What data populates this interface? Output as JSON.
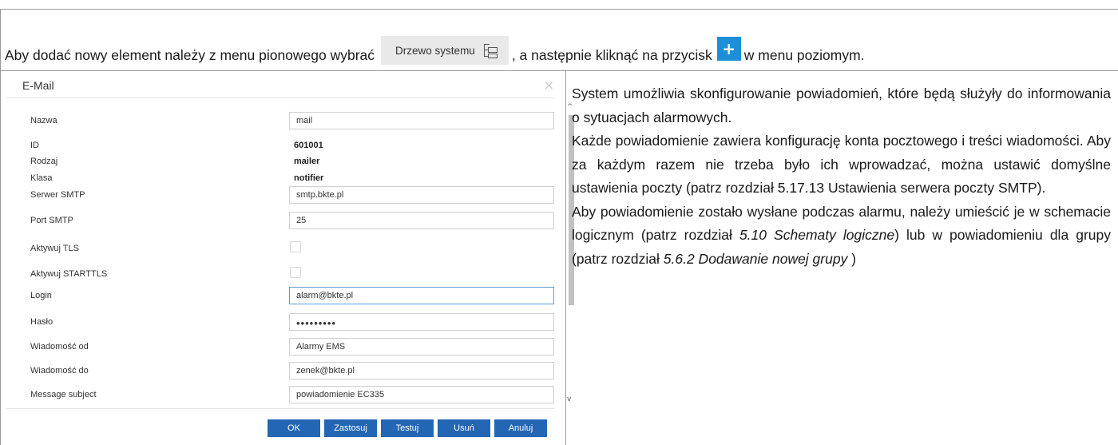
{
  "intro": {
    "text_before": "Aby dodać nowy element należy z menu pionowego wybrać",
    "tree_button_label": "Drzewo systemu",
    "text_middle": ", a następnie kliknąć na przycisk",
    "add_button_glyph": "+",
    "text_after": "w menu poziomym."
  },
  "dialog": {
    "title": "E-Mail",
    "close_glyph": "×",
    "fields": {
      "name": {
        "label": "Nazwa",
        "value": "mail"
      },
      "id": {
        "label": "ID",
        "value": "601001"
      },
      "kind": {
        "label": "Rodzaj",
        "value": "mailer"
      },
      "class": {
        "label": "Klasa",
        "value": "notifier"
      },
      "smtp_server": {
        "label": "Serwer SMTP",
        "value": "smtp.bkte.pl"
      },
      "smtp_port": {
        "label": "Port SMTP",
        "value": "25"
      },
      "tls": {
        "label": "Aktywuj TLS",
        "checked": false
      },
      "starttls": {
        "label": "Aktywuj STARTTLS",
        "checked": false
      },
      "login": {
        "label": "Login",
        "value": "alarm@bkte.pl"
      },
      "password": {
        "label": "Hasło",
        "value": "•••••••••"
      },
      "from": {
        "label": "Wiadomość od",
        "value": "Alarmy EMS"
      },
      "to": {
        "label": "Wiadomość do",
        "value": "zenek@bkte.pl"
      },
      "subject": {
        "label": "Message subject",
        "value": "powiadomienie EC335"
      }
    },
    "buttons": {
      "ok": "OK",
      "apply": "Zastosuj",
      "test": "Testuj",
      "delete": "Usuń",
      "cancel": "Anuluj"
    }
  },
  "description": {
    "p1": "System umożliwia skonfigurowanie powiadomień, które będą służyły do informowania o sytuacjach alarmowych.",
    "p2": "Każde powiadomienie zawiera konfigurację konta pocztowego i treści wiadomości. Aby za każdym razem nie trzeba było ich wprowadzać, można ustawić domyślne ustawienia poczty (patrz rozdział 5.17.13 Ustawienia serwera poczty SMTP).",
    "p3_a": "Aby powiadomienie zostało wysłane podczas alarmu, należy umieścić je w schemacie logicznym (patrz rozdział ",
    "p3_ref1": "5.10 Schematy logiczne",
    "p3_b": ") lub w powiadomieniu dla grupy (patrz rozdział ",
    "p3_ref2": "5.6.2 Dodawanie nowej grupy",
    "p3_c": " )"
  },
  "colors": {
    "button_blue": "#2266b5",
    "add_icon_blue": "#1e8fd6"
  }
}
